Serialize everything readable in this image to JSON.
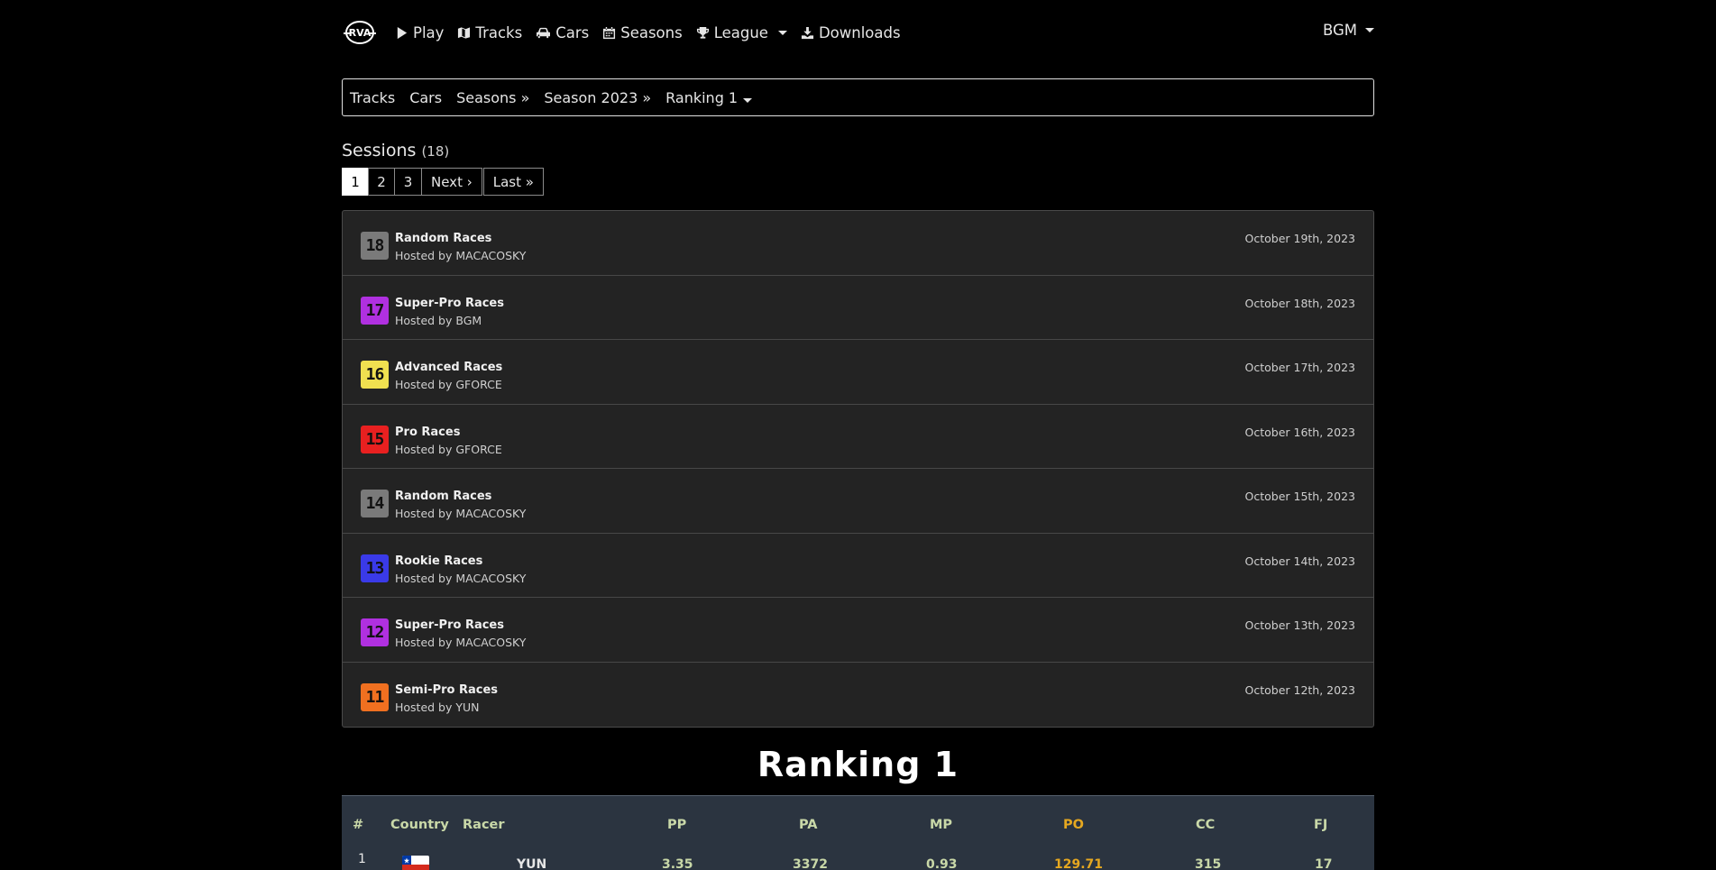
{
  "nav": {
    "items": [
      {
        "label": "Play",
        "icon": "play-icon"
      },
      {
        "label": "Tracks",
        "icon": "map-icon"
      },
      {
        "label": "Cars",
        "icon": "car-icon"
      },
      {
        "label": "Seasons",
        "icon": "calendar-icon"
      },
      {
        "label": "League",
        "icon": "trophy-icon"
      },
      {
        "label": "Downloads",
        "icon": "download-icon"
      }
    ],
    "user": "BGM"
  },
  "breadcrumb": {
    "tracks": "Tracks",
    "cars": "Cars",
    "seasons": "Seasons »",
    "season": "Season 2023 »",
    "ranking": "Ranking 1"
  },
  "sessions": {
    "title": "Sessions",
    "count": "(18)",
    "pager": {
      "p1": "1",
      "p2": "2",
      "p3": "3",
      "next": "Next ›",
      "last": "Last »"
    },
    "items": [
      {
        "num": "18",
        "title": "Random Races",
        "host": "Hosted by MACACOSKY",
        "date": "October 19th, 2023",
        "color": "#7a7a7a"
      },
      {
        "num": "17",
        "title": "Super-Pro Races",
        "host": "Hosted by BGM",
        "date": "October 18th, 2023",
        "color": "#b030e0"
      },
      {
        "num": "16",
        "title": "Advanced Races",
        "host": "Hosted by GFORCE",
        "date": "October 17th, 2023",
        "color": "#f0e050"
      },
      {
        "num": "15",
        "title": "Pro Races",
        "host": "Hosted by GFORCE",
        "date": "October 16th, 2023",
        "color": "#e82020"
      },
      {
        "num": "14",
        "title": "Random Races",
        "host": "Hosted by MACACOSKY",
        "date": "October 15th, 2023",
        "color": "#7a7a7a"
      },
      {
        "num": "13",
        "title": "Rookie Races",
        "host": "Hosted by MACACOSKY",
        "date": "October 14th, 2023",
        "color": "#3a3ae8"
      },
      {
        "num": "12",
        "title": "Super-Pro Races",
        "host": "Hosted by MACACOSKY",
        "date": "October 13th, 2023",
        "color": "#b030e0"
      },
      {
        "num": "11",
        "title": "Semi-Pro Races",
        "host": "Hosted by YUN",
        "date": "October 12th, 2023",
        "color": "#f07020"
      }
    ]
  },
  "ranking": {
    "title": "Ranking 1",
    "headers": {
      "num": "#",
      "country": "Country",
      "racer": "Racer",
      "pp": "PP",
      "pa": "PA",
      "mp": "MP",
      "po": "PO",
      "cc": "CC",
      "fj": "FJ"
    },
    "rows": [
      {
        "num": "1",
        "racer": "YUN",
        "pp": "3.35",
        "pa": "3372",
        "mp": "0.93",
        "po": "129.71",
        "cc": "315",
        "fj": "17"
      }
    ]
  }
}
